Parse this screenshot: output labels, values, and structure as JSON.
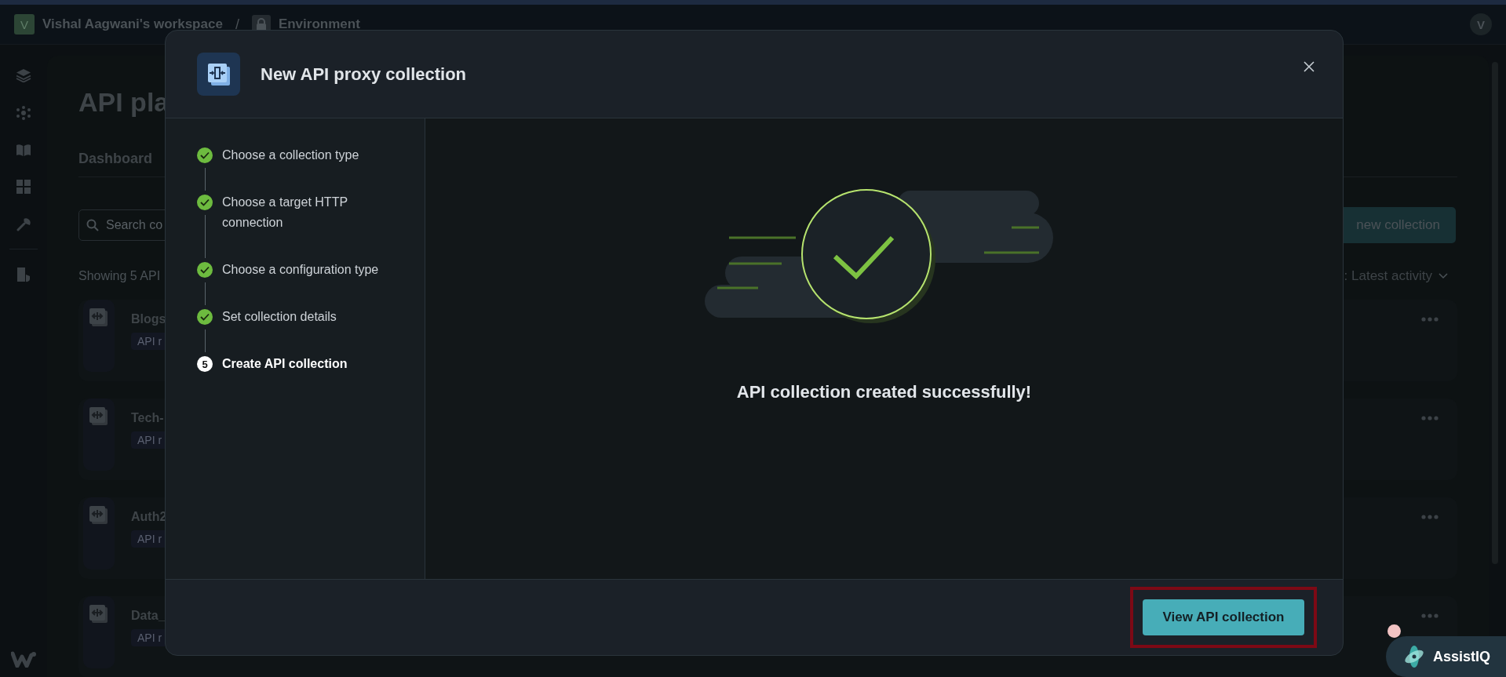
{
  "top_bar": {
    "workspace_avatar": "V",
    "workspace": "Vishal Aagwani's workspace",
    "separator": "/",
    "environment": "Environment",
    "user_avatar": "V"
  },
  "page": {
    "title": "API pla",
    "tab": "Dashboard",
    "search": {
      "placeholder": "Search co"
    },
    "new_button": "new collection",
    "count": "Showing 5 API",
    "sort": ": Latest activity",
    "collections": [
      {
        "name": "Blogs",
        "tag": "API r"
      },
      {
        "name": "Tech-",
        "tag": "API r"
      },
      {
        "name": "Auth2",
        "tag": "API r"
      },
      {
        "name": "Data_",
        "tag": "API r"
      }
    ]
  },
  "dialog": {
    "title": "New API proxy collection",
    "steps": [
      {
        "label": "Choose a collection type",
        "completed": true
      },
      {
        "label": "Choose a target HTTP connection",
        "completed": true
      },
      {
        "label": "Choose a configuration type",
        "completed": true
      },
      {
        "label": "Set collection details",
        "completed": true
      },
      {
        "label": "Create API collection",
        "completed": false,
        "number": "5"
      }
    ],
    "message": "API collection created successfully!",
    "primary_button": "View API collection",
    "highlighted": true
  },
  "assistant": {
    "label": "AssistIQ",
    "notification": true
  }
}
